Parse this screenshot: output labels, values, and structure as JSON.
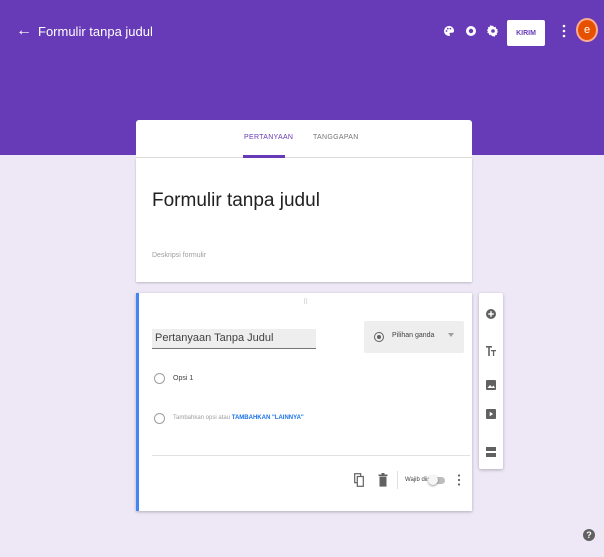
{
  "topbar": {
    "back_glyph": "←",
    "title": "Formulir tanpa judul",
    "icons": [
      "palette-icon",
      "preview-icon",
      "settings-icon"
    ],
    "send_label": "KIRIM",
    "avatar_letter": "e"
  },
  "tabs": [
    {
      "label": "PERTANYAAN",
      "active": true
    },
    {
      "label": "TANGGAPAN",
      "active": false
    }
  ],
  "form": {
    "title": "Formulir tanpa judul",
    "description_placeholder": "Deskripsi formulir"
  },
  "question": {
    "drag_handle": "⠿",
    "text": "Pertanyaan Tanpa Judul",
    "type_label": "Pilihan ganda",
    "options": [
      "Opsi 1"
    ],
    "add_option_text": "Tambahkan opsi",
    "add_option_or": "atau",
    "add_other_text": "TAMBAHKAN \"LAINNYA\"",
    "required_label": "Wajib diisi"
  },
  "sidebar_icons": [
    "add-question-icon",
    "add-title-icon",
    "add-image-icon",
    "add-video-icon",
    "add-section-icon"
  ],
  "help_glyph": "?",
  "colors": {
    "header": "#673ab7",
    "background": "#ede7f6",
    "accent_blue": "#4285f4",
    "avatar": "#e65100"
  }
}
